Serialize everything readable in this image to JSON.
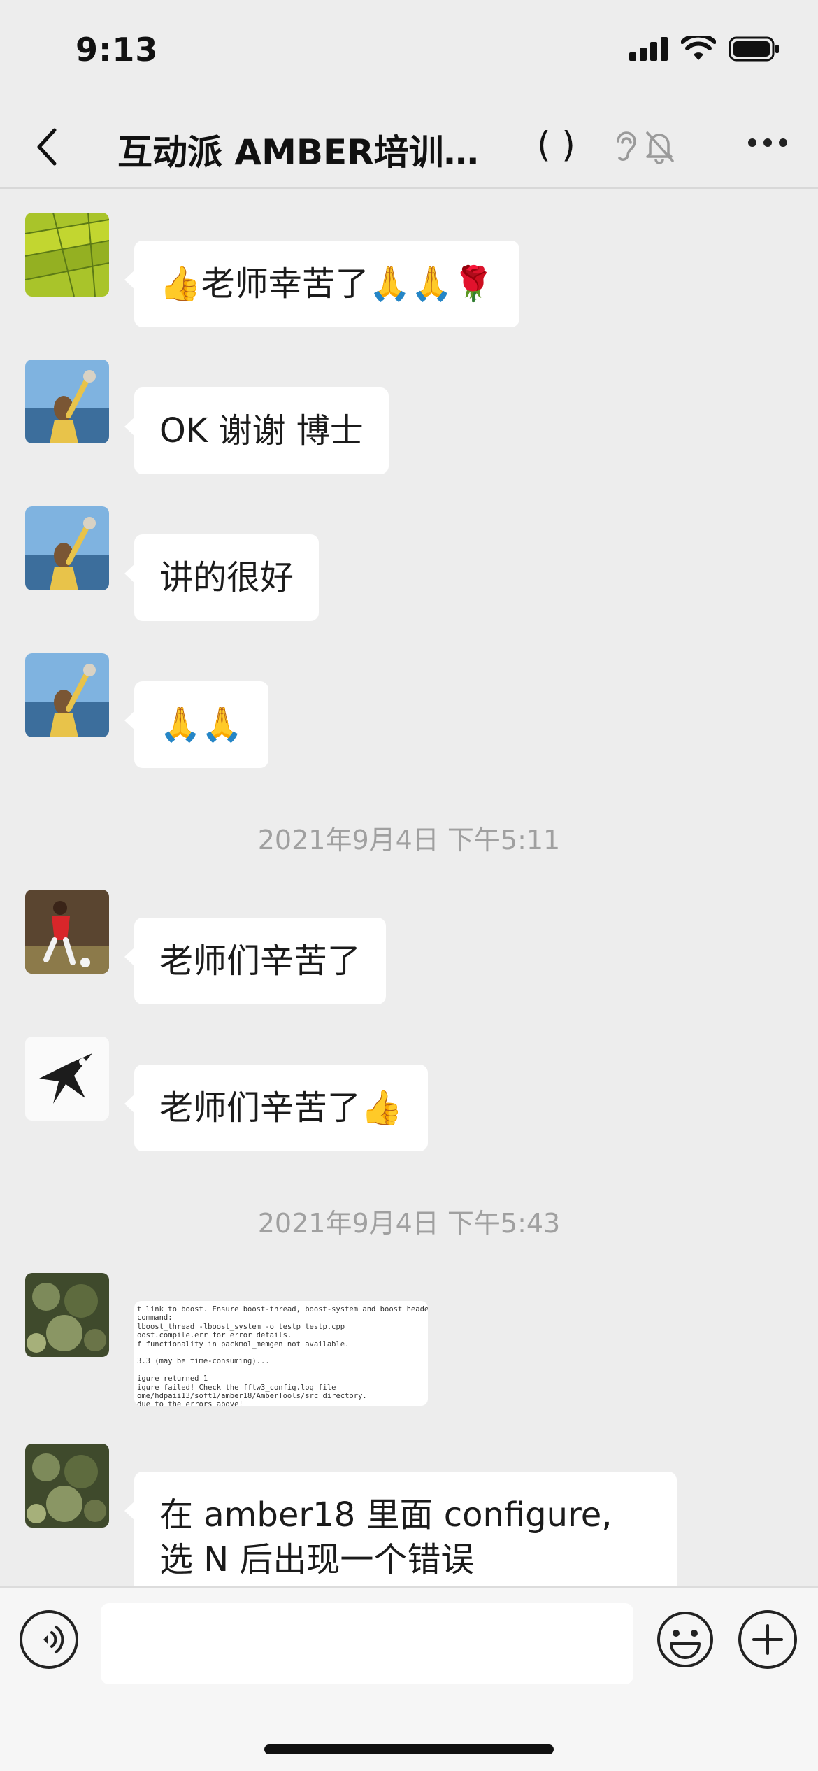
{
  "status": {
    "time": "9:13"
  },
  "header": {
    "title": "互动派 AMBER培训班...",
    "count_paren": "(    )"
  },
  "messages": [
    {
      "type": "text",
      "avatar": "rice-field-avatar",
      "text": "👍老师幸苦了🙏🙏🌹"
    },
    {
      "type": "text",
      "avatar": "girl-sea-avatar",
      "text": "OK 谢谢   博士"
    },
    {
      "type": "text",
      "avatar": "girl-sea-avatar",
      "text": "讲的很好"
    },
    {
      "type": "text",
      "avatar": "girl-sea-avatar",
      "text": "🙏🙏"
    },
    {
      "type": "time",
      "text": "2021年9月4日 下午5:11"
    },
    {
      "type": "text",
      "avatar": "soccer-player-avatar",
      "text": "老师们辛苦了"
    },
    {
      "type": "text",
      "avatar": "magpie-avatar",
      "text": "老师们辛苦了👍"
    },
    {
      "type": "time",
      "text": "2021年9月4日 下午5:43"
    },
    {
      "type": "image",
      "avatar": "bronze-dragon-avatar",
      "lines": [
        "t link to boost. Ensure boost-thread, boost-system and boost headers",
        "command:",
        "lboost_thread -lboost_system -o testp testp.cpp",
        "oost.compile.err for error details.",
        "f functionality in packmol_memgen not available.",
        "",
        "3.3 (may be time-consuming)...",
        "",
        "igure returned 1",
        "igure failed! Check the fftw3_config.log file",
        "ome/hdpaii13/soft1/amber18/AmberTools/src directory.",
        "due to the errors above!"
      ]
    },
    {
      "type": "text",
      "avatar": "bronze-dragon-avatar",
      "text": "在 amber18 里面 configure, 选 N 后出现一个错误"
    }
  ],
  "input": {
    "placeholder": ""
  },
  "colors": {
    "background": "#ededed",
    "bubble": "#ffffff",
    "timestamp": "#a0a0a0"
  }
}
